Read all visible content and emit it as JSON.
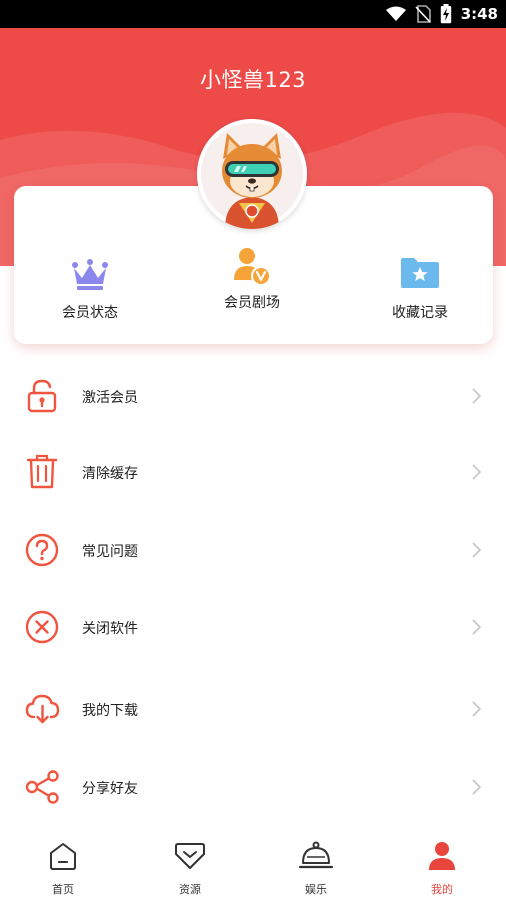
{
  "status_bar": {
    "time": "3:48"
  },
  "profile": {
    "username": "小怪兽123"
  },
  "card": {
    "items": [
      {
        "label": "会员状态",
        "icon": "crown-icon"
      },
      {
        "label": "会员剧场",
        "icon": "vip-user-icon"
      },
      {
        "label": "收藏记录",
        "icon": "star-folder-icon"
      }
    ]
  },
  "menu": {
    "items": [
      {
        "label": "激活会员",
        "icon": "unlock-icon"
      },
      {
        "label": "清除缓存",
        "icon": "trash-icon"
      },
      {
        "label": "常见问题",
        "icon": "question-icon"
      },
      {
        "label": "关闭软件",
        "icon": "close-circle-icon"
      },
      {
        "label": "我的下载",
        "icon": "cloud-download-icon"
      },
      {
        "label": "分享好友",
        "icon": "share-icon"
      }
    ]
  },
  "bottom_nav": {
    "items": [
      {
        "label": "首页",
        "icon": "home-icon"
      },
      {
        "label": "资源",
        "icon": "resource-icon"
      },
      {
        "label": "娱乐",
        "icon": "cloche-icon"
      },
      {
        "label": "我的",
        "icon": "user-icon"
      }
    ],
    "active_index": 3
  },
  "colors": {
    "brand_red": "#ed4a48",
    "icon_orange": "#f0553f",
    "active_nav": "#e8453c",
    "crown_purple": "#8b87ec",
    "vip_orange": "#f6a33a",
    "folder_blue": "#6cb9ee"
  }
}
